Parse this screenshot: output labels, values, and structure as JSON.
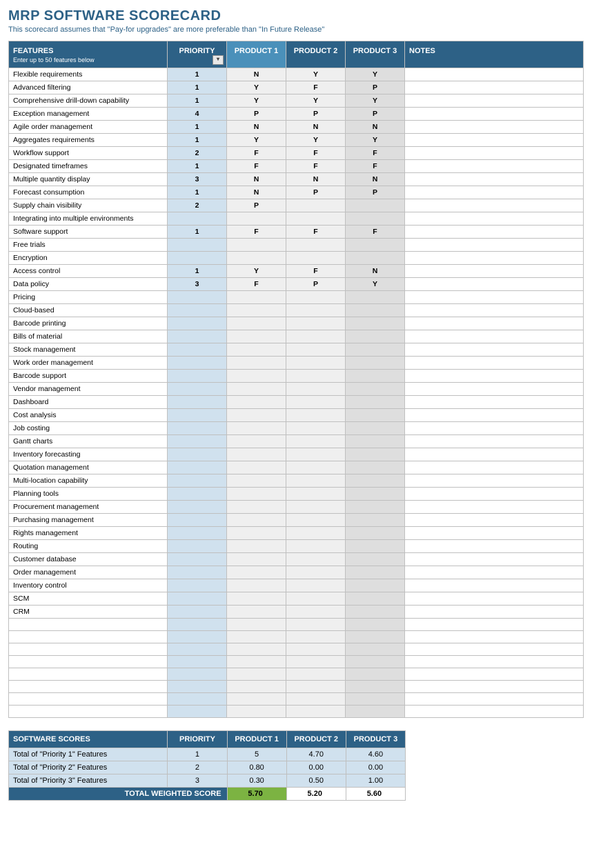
{
  "title": "MRP SOFTWARE SCORECARD",
  "subtitle": "This scorecard assumes that \"Pay-for upgrades\" are more preferable than \"In Future Release\"",
  "headers": {
    "features": "FEATURES",
    "features_sub": "Enter up to 50 features below",
    "priority": "PRIORITY",
    "product1": "PRODUCT 1",
    "product2": "PRODUCT 2",
    "product3": "PRODUCT 3",
    "notes": "NOTES"
  },
  "rows": [
    {
      "feature": "Flexible requirements",
      "priority": "1",
      "p1": "N",
      "p2": "Y",
      "p3": "Y"
    },
    {
      "feature": "Advanced filtering",
      "priority": "1",
      "p1": "Y",
      "p2": "F",
      "p3": "P"
    },
    {
      "feature": "Comprehensive drill-down capability",
      "priority": "1",
      "p1": "Y",
      "p2": "Y",
      "p3": "Y"
    },
    {
      "feature": "Exception management",
      "priority": "4",
      "p1": "P",
      "p2": "P",
      "p3": "P"
    },
    {
      "feature": "Agile order management",
      "priority": "1",
      "p1": "N",
      "p2": "N",
      "p3": "N"
    },
    {
      "feature": "Aggregates requirements",
      "priority": "1",
      "p1": "Y",
      "p2": "Y",
      "p3": "Y"
    },
    {
      "feature": "Workflow support",
      "priority": "2",
      "p1": "F",
      "p2": "F",
      "p3": "F"
    },
    {
      "feature": "Designated timeframes",
      "priority": "1",
      "p1": "F",
      "p2": "F",
      "p3": "F"
    },
    {
      "feature": "Multiple quantity display",
      "priority": "3",
      "p1": "N",
      "p2": "N",
      "p3": "N"
    },
    {
      "feature": "Forecast consumption",
      "priority": "1",
      "p1": "N",
      "p2": "P",
      "p3": "P"
    },
    {
      "feature": "Supply chain visibility",
      "priority": "2",
      "p1": "P",
      "p2": "",
      "p3": ""
    },
    {
      "feature": "Integrating into multiple environments",
      "priority": "",
      "p1": "",
      "p2": "",
      "p3": ""
    },
    {
      "feature": "Software support",
      "priority": "1",
      "p1": "F",
      "p2": "F",
      "p3": "F"
    },
    {
      "feature": "Free trials",
      "priority": "",
      "p1": "",
      "p2": "",
      "p3": ""
    },
    {
      "feature": "Encryption",
      "priority": "",
      "p1": "",
      "p2": "",
      "p3": ""
    },
    {
      "feature": "Access control",
      "priority": "1",
      "p1": "Y",
      "p2": "F",
      "p3": "N"
    },
    {
      "feature": "Data policy",
      "priority": "3",
      "p1": "F",
      "p2": "P",
      "p3": "Y"
    },
    {
      "feature": "Pricing",
      "priority": "",
      "p1": "",
      "p2": "",
      "p3": ""
    },
    {
      "feature": "Cloud-based",
      "priority": "",
      "p1": "",
      "p2": "",
      "p3": ""
    },
    {
      "feature": "Barcode printing",
      "priority": "",
      "p1": "",
      "p2": "",
      "p3": ""
    },
    {
      "feature": "Bills of material",
      "priority": "",
      "p1": "",
      "p2": "",
      "p3": ""
    },
    {
      "feature": "Stock management",
      "priority": "",
      "p1": "",
      "p2": "",
      "p3": ""
    },
    {
      "feature": "Work order management",
      "priority": "",
      "p1": "",
      "p2": "",
      "p3": ""
    },
    {
      "feature": "Barcode support",
      "priority": "",
      "p1": "",
      "p2": "",
      "p3": ""
    },
    {
      "feature": "Vendor management",
      "priority": "",
      "p1": "",
      "p2": "",
      "p3": ""
    },
    {
      "feature": "Dashboard",
      "priority": "",
      "p1": "",
      "p2": "",
      "p3": ""
    },
    {
      "feature": "Cost analysis",
      "priority": "",
      "p1": "",
      "p2": "",
      "p3": ""
    },
    {
      "feature": "Job costing",
      "priority": "",
      "p1": "",
      "p2": "",
      "p3": ""
    },
    {
      "feature": "Gantt charts",
      "priority": "",
      "p1": "",
      "p2": "",
      "p3": ""
    },
    {
      "feature": "Inventory forecasting",
      "priority": "",
      "p1": "",
      "p2": "",
      "p3": ""
    },
    {
      "feature": "Quotation management",
      "priority": "",
      "p1": "",
      "p2": "",
      "p3": ""
    },
    {
      "feature": "Multi-location capability",
      "priority": "",
      "p1": "",
      "p2": "",
      "p3": ""
    },
    {
      "feature": "Planning tools",
      "priority": "",
      "p1": "",
      "p2": "",
      "p3": ""
    },
    {
      "feature": "Procurement management",
      "priority": "",
      "p1": "",
      "p2": "",
      "p3": ""
    },
    {
      "feature": "Purchasing management",
      "priority": "",
      "p1": "",
      "p2": "",
      "p3": ""
    },
    {
      "feature": "Rights management",
      "priority": "",
      "p1": "",
      "p2": "",
      "p3": ""
    },
    {
      "feature": "Routing",
      "priority": "",
      "p1": "",
      "p2": "",
      "p3": ""
    },
    {
      "feature": "Customer database",
      "priority": "",
      "p1": "",
      "p2": "",
      "p3": ""
    },
    {
      "feature": "Order management",
      "priority": "",
      "p1": "",
      "p2": "",
      "p3": ""
    },
    {
      "feature": "Inventory control",
      "priority": "",
      "p1": "",
      "p2": "",
      "p3": ""
    },
    {
      "feature": "SCM",
      "priority": "",
      "p1": "",
      "p2": "",
      "p3": ""
    },
    {
      "feature": "CRM",
      "priority": "",
      "p1": "",
      "p2": "",
      "p3": ""
    },
    {
      "feature": "",
      "priority": "",
      "p1": "",
      "p2": "",
      "p3": ""
    },
    {
      "feature": "",
      "priority": "",
      "p1": "",
      "p2": "",
      "p3": ""
    },
    {
      "feature": "",
      "priority": "",
      "p1": "",
      "p2": "",
      "p3": ""
    },
    {
      "feature": "",
      "priority": "",
      "p1": "",
      "p2": "",
      "p3": ""
    },
    {
      "feature": "",
      "priority": "",
      "p1": "",
      "p2": "",
      "p3": ""
    },
    {
      "feature": "",
      "priority": "",
      "p1": "",
      "p2": "",
      "p3": ""
    },
    {
      "feature": "",
      "priority": "",
      "p1": "",
      "p2": "",
      "p3": ""
    },
    {
      "feature": "",
      "priority": "",
      "p1": "",
      "p2": "",
      "p3": ""
    }
  ],
  "scores": {
    "header": {
      "label": "SOFTWARE SCORES",
      "priority": "PRIORITY",
      "p1": "PRODUCT 1",
      "p2": "PRODUCT 2",
      "p3": "PRODUCT 3"
    },
    "rows": [
      {
        "label": "Total of \"Priority 1\" Features",
        "priority": "1",
        "p1": "5",
        "p2": "4.70",
        "p3": "4.60"
      },
      {
        "label": "Total of \"Priority 2\" Features",
        "priority": "2",
        "p1": "0.80",
        "p2": "0.00",
        "p3": "0.00"
      },
      {
        "label": "Total of \"Priority 3\" Features",
        "priority": "3",
        "p1": "0.30",
        "p2": "0.50",
        "p3": "1.00"
      }
    ],
    "total_label": "TOTAL WEIGHTED SCORE",
    "totals": {
      "p1": "5.70",
      "p2": "5.20",
      "p3": "5.60"
    }
  }
}
